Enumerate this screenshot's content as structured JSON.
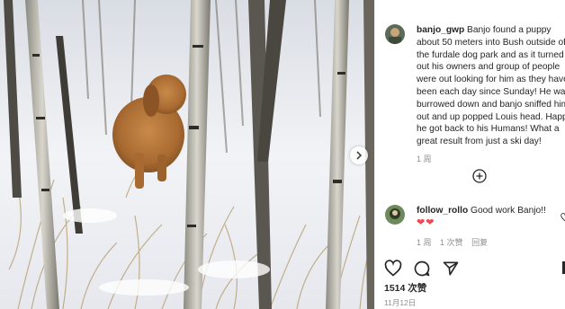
{
  "post": {
    "username": "banjo_gwp",
    "caption_lines": [
      "Banjo found a puppy",
      "about 50 meters into Bush outside of",
      "the furdale dog park and as it turned",
      "out his owners and group of people",
      "were out looking for him as they have",
      "been each day since Sunday! He was",
      "burrowed down and banjo sniffed him",
      "out and up popped Louis head. Happy",
      "he got back to his Humans! What a",
      "great result from just a ski day!"
    ],
    "caption_time": "1 周"
  },
  "comment": {
    "username": "follow_rollo",
    "text": "Good work Banjo!!",
    "emoji": "❤❤",
    "time": "1 周",
    "likes": "1 次赞",
    "reply": "回复"
  },
  "footer": {
    "likes": "1514 次赞",
    "date": "11月12日"
  },
  "icons": {
    "next": "chevron-right-icon",
    "load_more": "plus-circle-icon",
    "like": "heart-outline-icon",
    "comment": "speech-bubble-icon",
    "share": "paper-plane-icon"
  },
  "colors": {
    "heart": "#ed4956",
    "text": "#262626",
    "muted": "#8e8e8e"
  }
}
